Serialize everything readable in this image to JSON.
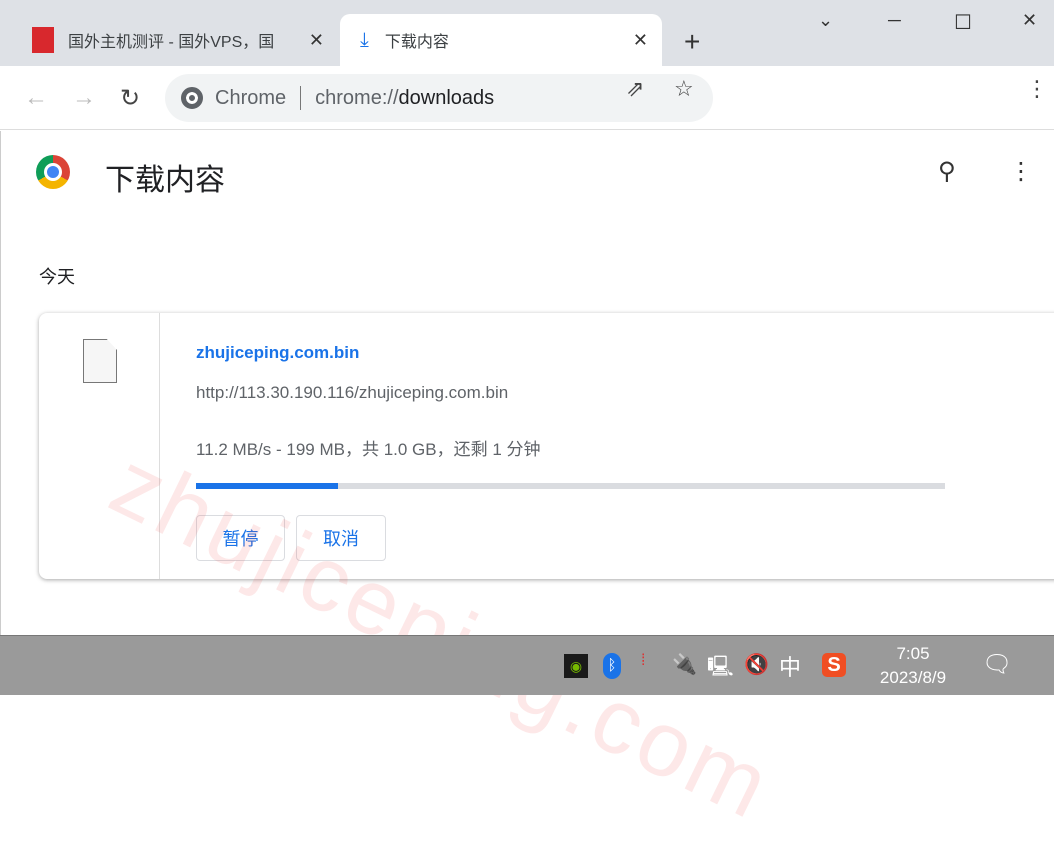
{
  "tabs": [
    {
      "title": "国外主机测评 - 国外VPS，国",
      "close": "✕"
    },
    {
      "title": "下载内容",
      "icon": "download-icon",
      "close": "✕"
    }
  ],
  "new_tab": "+",
  "window_controls": {
    "minimize": "─",
    "maximize": "☐",
    "close": "✕",
    "tab_search": "⌄"
  },
  "omnibox": {
    "site": "Chrome",
    "url_prefix": "chrome://",
    "url_main": "downloads"
  },
  "page": {
    "title": "下载内容",
    "section": "今天",
    "watermark": "zhujiceping.com"
  },
  "download": {
    "filename": "zhujiceping.com.bin",
    "url": "http://113.30.190.116/zhujiceping.com.bin",
    "status": "11.2 MB/s - 199 MB，共 1.0 GB，还剩 1 分钟",
    "progress_percent": 19,
    "pause": "暂停",
    "cancel": "取消"
  },
  "taskbar": {
    "ime": "中",
    "time": "7:05",
    "date": "2023/8/9"
  },
  "colors": {
    "accent": "#1a73e8",
    "tabbar": "#dee1e6",
    "taskbar": "#9a9a9a"
  }
}
